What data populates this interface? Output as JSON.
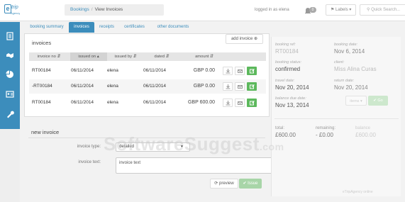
{
  "brand": {
    "logo_letter": "e",
    "logo_name": "trip",
    "logo_sub": "Agency"
  },
  "topbar": {
    "breadcrumb_root": "Bookings",
    "breadcrumb_sep": "/",
    "breadcrumb_current": "View Invoices",
    "logged_in": "logged in as elena",
    "notifications_count": "0",
    "labels_button": "Labels",
    "quick_search_placeholder": "Quick Search..."
  },
  "tabs": [
    {
      "label": "booking summary",
      "active": false
    },
    {
      "label": "invoices",
      "active": true
    },
    {
      "label": "receipts",
      "active": false
    },
    {
      "label": "certificates",
      "active": false
    },
    {
      "label": "other documents",
      "active": false
    }
  ],
  "invoices": {
    "title": "invoices",
    "add_button": "add invoice",
    "columns": [
      "invoice no",
      "issued on",
      "issued by",
      "dated",
      "amount"
    ],
    "rows": [
      {
        "invoice_no": "RT00184",
        "issued_on": "06/11/2014",
        "issued_by": "elena",
        "dated": "06/11/2014",
        "amount": "GBP 0.00"
      },
      {
        "invoice_no": "-RT00184",
        "issued_on": "06/11/2014",
        "issued_by": "elena",
        "dated": "06/11/2014",
        "amount": "GBP 0.00"
      },
      {
        "invoice_no": "RT00184",
        "issued_on": "06/11/2014",
        "issued_by": "elena",
        "dated": "06/11/2014",
        "amount": "GBP 600.00"
      }
    ]
  },
  "new_invoice": {
    "title": "new invoice",
    "type_label": "invoice type:",
    "type_value": "detailed",
    "text_label": "invoice text:",
    "text_value": "invoice text",
    "preview_button": "preview",
    "issue_button": "Issue"
  },
  "summary": {
    "booking_ref_label": "booking ref:",
    "booking_ref": "RT00184",
    "booking_date_label": "booking date:",
    "booking_date": "Nov 6, 2014",
    "booking_status_label": "booking status:",
    "booking_status": "confirmed",
    "client_label": "client:",
    "client": "Miss Alina Curas",
    "travel_date_label": "travel date:",
    "travel_date": "Nov 20, 2014",
    "return_date_label": "return date:",
    "return_date": "Nov 20, 2014",
    "balance_due_label": "balance due date:",
    "balance_due": "Nov 13, 2014",
    "action_button_1": "items",
    "action_button_2": "Go",
    "total_label": "total:",
    "total": "£600.00",
    "remaining_label": "remaining:",
    "remaining": "- £0.00",
    "balance_label": "balance",
    "balance": "£600.00",
    "powered": "eTripAgency online"
  },
  "watermark": {
    "main": "SoftwareSuggest",
    "suffix": ".com"
  }
}
